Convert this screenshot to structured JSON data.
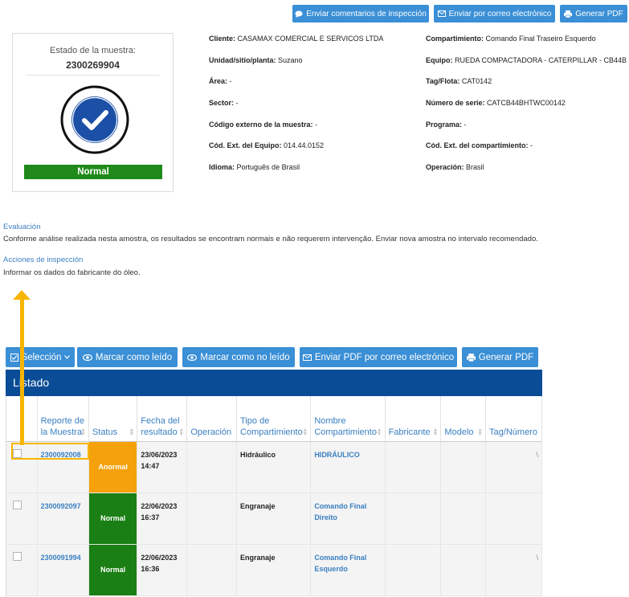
{
  "toolbar_top": {
    "send_comments": "Enviar comentarios de inspección",
    "send_email": "Enviar por correo electrónico",
    "generate_pdf": "Generar PDF"
  },
  "sample_status": {
    "title": "Estado de la muestra:",
    "sample_id": "2300269904",
    "status": "Normal",
    "status_color": "#1f8a1a"
  },
  "details": {
    "left": [
      {
        "label": "Cliente:",
        "value": "CASAMAX COMERCIAL E SERVICOS LTDA"
      },
      {
        "label": "Unidad/sitio/planta:",
        "value": "Suzano"
      },
      {
        "label": "Área:",
        "value": "-"
      },
      {
        "label": "Sector:",
        "value": "-"
      },
      {
        "label": "Código externo de la muestra:",
        "value": "-"
      },
      {
        "label": "Cód. Ext. del Equipo:",
        "value": "014.44.0152"
      },
      {
        "label": "Idioma:",
        "value": "Português de Brasil"
      }
    ],
    "right": [
      {
        "label": "Compartimiento:",
        "value": "Comando Final Traseiro Esquerdo"
      },
      {
        "label": "Equipo:",
        "value": "RUEDA COMPACTADORA - CATERPILLAR - CB44B"
      },
      {
        "label": "Tag/Flota:",
        "value": "CAT0142"
      },
      {
        "label": "Número de serie:",
        "value": "CATCB44BHTWC00142"
      },
      {
        "label": "Programa:",
        "value": "-"
      },
      {
        "label": "Cód. Ext. del compartimiento:",
        "value": "-"
      },
      {
        "label": "Operación:",
        "value": "Brasil"
      }
    ]
  },
  "evaluation": {
    "label": "Evaluación",
    "text": "Conforme análise realizada nesta amostra, os resultados se encontram normais e não requerem intervenção. Enviar nova amostra no intervalo recomendado."
  },
  "inspection_actions": {
    "label": "Acciones de inspección",
    "text": "Informar os dados do fabricante do óleo."
  },
  "toolbar_list": {
    "selection": "Selección",
    "mark_read": "Marcar como leído",
    "mark_unread": "Marcar como no leído",
    "send_pdf_email": "Enviar PDF por correo electrónico",
    "generate_pdf": "Generar PDF"
  },
  "listing": {
    "title": "Listado",
    "columns": {
      "report": "Reporte de la Muestra",
      "status": "Status",
      "date": "Fecha del resultado",
      "operation": "Operación",
      "compartment_type": "Tipo de Compartimiento",
      "compartment_name": "Nombre Compartimiento",
      "manufacturer": "Fabricante",
      "model": "Modelo",
      "tag": "Tag/Número"
    },
    "rows": [
      {
        "report": "2300092008",
        "status": "Anormal",
        "status_color": "#f5a10c",
        "date": "23/06/2023 14:47",
        "operation": "",
        "compartment_type": "Hidráulico",
        "compartment_name": "HIDRÁULICO",
        "manufacturer": "",
        "model": "",
        "tag": "\\"
      },
      {
        "report": "2300092097",
        "status": "Normal",
        "status_color": "#1a7f14",
        "date": "22/06/2023 16:37",
        "operation": "",
        "compartment_type": "Engranaje",
        "compartment_name": "Comando Final Direito",
        "manufacturer": "",
        "model": "",
        "tag": ""
      },
      {
        "report": "2300091994",
        "status": "Normal",
        "status_color": "#1a7f14",
        "date": "22/06/2023 16:36",
        "operation": "",
        "compartment_type": "Engranaje",
        "compartment_name": "Comando Final Esquerdo",
        "manufacturer": "",
        "model": "",
        "tag": "\\"
      }
    ]
  },
  "colors": {
    "button_blue": "#3a8fd6",
    "header_blue": "#0a4d96",
    "link_blue": "#3a7fc1",
    "highlight_yellow": "#f7b500"
  }
}
